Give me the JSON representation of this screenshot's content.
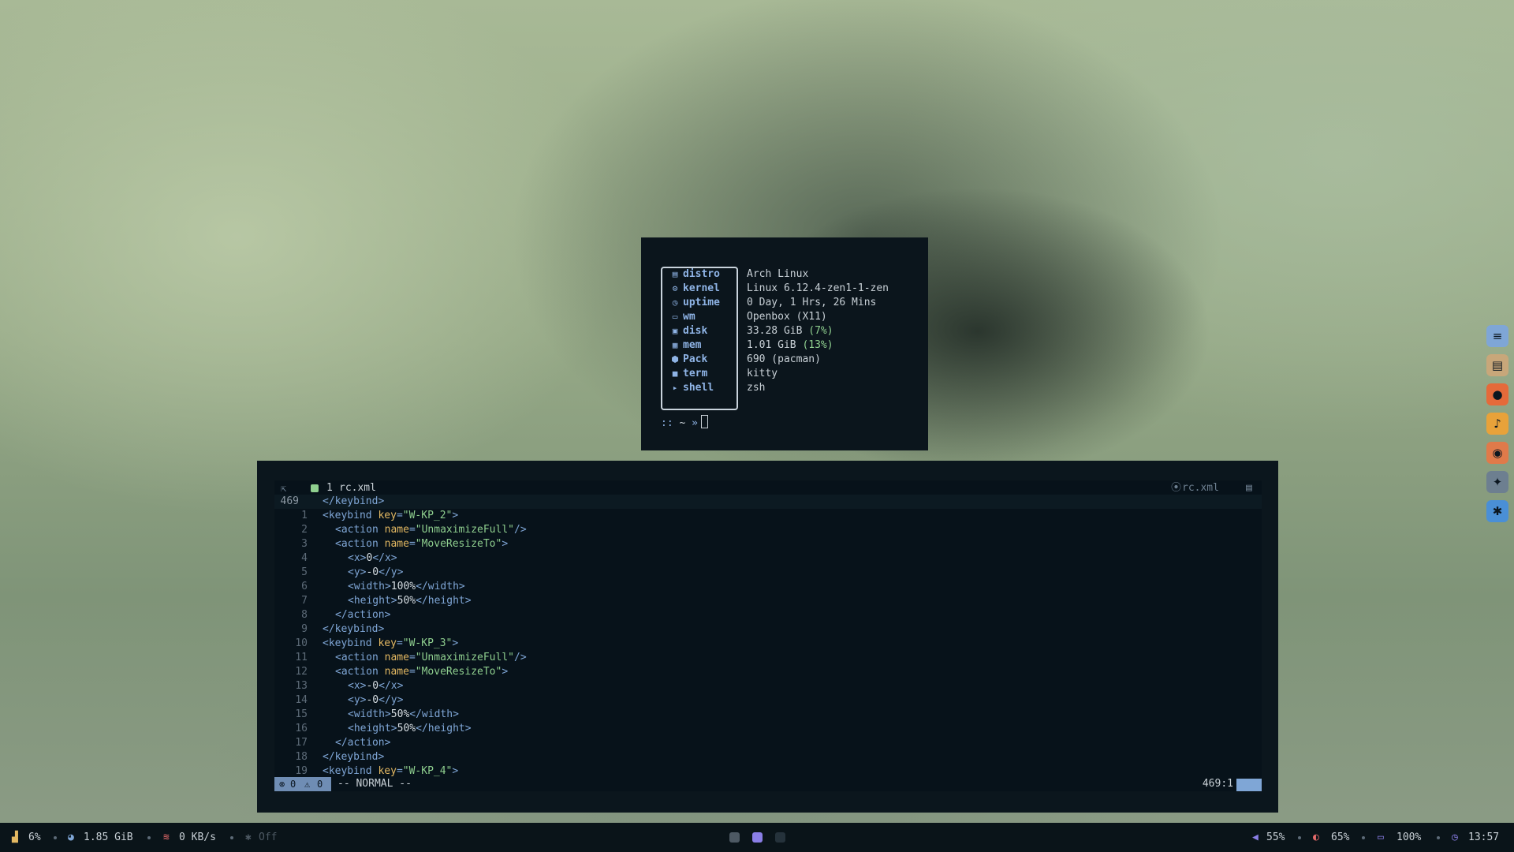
{
  "fetch": {
    "rows": [
      {
        "icon": "distro-icon",
        "glyph": "▤",
        "label": "distro",
        "value": "Arch Linux"
      },
      {
        "icon": "kernel-icon",
        "glyph": "⚙",
        "label": "kernel",
        "value": "Linux 6.12.4-zen1-1-zen"
      },
      {
        "icon": "uptime-icon",
        "glyph": "◷",
        "label": "uptime",
        "value": "0 Day, 1 Hrs, 26 Mins"
      },
      {
        "icon": "monitor-icon",
        "glyph": "▭",
        "label": "wm",
        "value": "Openbox (X11)"
      },
      {
        "icon": "disk-icon",
        "glyph": "▣",
        "label": "disk",
        "value": "33.28 GiB ",
        "accent": "(7%)"
      },
      {
        "icon": "memory-icon",
        "glyph": "▦",
        "label": "mem",
        "value": "1.01 GiB ",
        "accent": "(13%)"
      },
      {
        "icon": "package-icon",
        "glyph": "⬢",
        "label": "Pack",
        "value": "690 (pacman)"
      },
      {
        "icon": "terminal-icon",
        "glyph": "■",
        "label": "term",
        "value": "kitty"
      },
      {
        "icon": "shell-icon",
        "glyph": "▸",
        "label": "shell",
        "value": "zsh"
      }
    ],
    "prompt": {
      "prefix": "::",
      "dir": "~",
      "arrow": "»"
    }
  },
  "editor": {
    "tab_number": "1",
    "tab_filename": "rc.xml",
    "winbar_filename": "rc.xml",
    "current_line_number": "469",
    "lines": [
      {
        "ln": "469",
        "indent": 0,
        "tokens": [
          [
            "tag",
            "</keybind>"
          ]
        ]
      },
      {
        "ln": "1",
        "indent": 0,
        "tokens": [
          [
            "tag",
            "<keybind "
          ],
          [
            "attr",
            "key"
          ],
          [
            "tag",
            "="
          ],
          [
            "str",
            "\"W-KP_2\""
          ],
          [
            "tag",
            ">"
          ]
        ]
      },
      {
        "ln": "2",
        "indent": 1,
        "tokens": [
          [
            "tag",
            "<action "
          ],
          [
            "attr",
            "name"
          ],
          [
            "tag",
            "="
          ],
          [
            "str",
            "\"UnmaximizeFull\""
          ],
          [
            "tag",
            "/>"
          ]
        ]
      },
      {
        "ln": "3",
        "indent": 1,
        "tokens": [
          [
            "tag",
            "<action "
          ],
          [
            "attr",
            "name"
          ],
          [
            "tag",
            "="
          ],
          [
            "str",
            "\"MoveResizeTo\""
          ],
          [
            "tag",
            ">"
          ]
        ]
      },
      {
        "ln": "4",
        "indent": 2,
        "tokens": [
          [
            "tag",
            "<x>"
          ],
          [
            "txt",
            "0"
          ],
          [
            "tag",
            "</x>"
          ]
        ]
      },
      {
        "ln": "5",
        "indent": 2,
        "tokens": [
          [
            "tag",
            "<y>"
          ],
          [
            "txt",
            "-0"
          ],
          [
            "tag",
            "</y>"
          ]
        ]
      },
      {
        "ln": "6",
        "indent": 2,
        "tokens": [
          [
            "tag",
            "<width>"
          ],
          [
            "txt",
            "100%"
          ],
          [
            "tag",
            "</width>"
          ]
        ]
      },
      {
        "ln": "7",
        "indent": 2,
        "tokens": [
          [
            "tag",
            "<height>"
          ],
          [
            "txt",
            "50%"
          ],
          [
            "tag",
            "</height>"
          ]
        ]
      },
      {
        "ln": "8",
        "indent": 1,
        "tokens": [
          [
            "tag",
            "</action>"
          ]
        ]
      },
      {
        "ln": "9",
        "indent": 0,
        "tokens": [
          [
            "tag",
            "</keybind>"
          ]
        ]
      },
      {
        "ln": "10",
        "indent": 0,
        "tokens": [
          [
            "tag",
            "<keybind "
          ],
          [
            "attr",
            "key"
          ],
          [
            "tag",
            "="
          ],
          [
            "str",
            "\"W-KP_3\""
          ],
          [
            "tag",
            ">"
          ]
        ]
      },
      {
        "ln": "11",
        "indent": 1,
        "tokens": [
          [
            "tag",
            "<action "
          ],
          [
            "attr",
            "name"
          ],
          [
            "tag",
            "="
          ],
          [
            "str",
            "\"UnmaximizeFull\""
          ],
          [
            "tag",
            "/>"
          ]
        ]
      },
      {
        "ln": "12",
        "indent": 1,
        "tokens": [
          [
            "tag",
            "<action "
          ],
          [
            "attr",
            "name"
          ],
          [
            "tag",
            "="
          ],
          [
            "str",
            "\"MoveResizeTo\""
          ],
          [
            "tag",
            ">"
          ]
        ]
      },
      {
        "ln": "13",
        "indent": 2,
        "tokens": [
          [
            "tag",
            "<x>"
          ],
          [
            "txt",
            "-0"
          ],
          [
            "tag",
            "</x>"
          ]
        ]
      },
      {
        "ln": "14",
        "indent": 2,
        "tokens": [
          [
            "tag",
            "<y>"
          ],
          [
            "txt",
            "-0"
          ],
          [
            "tag",
            "</y>"
          ]
        ]
      },
      {
        "ln": "15",
        "indent": 2,
        "tokens": [
          [
            "tag",
            "<width>"
          ],
          [
            "txt",
            "50%"
          ],
          [
            "tag",
            "</width>"
          ]
        ]
      },
      {
        "ln": "16",
        "indent": 2,
        "tokens": [
          [
            "tag",
            "<height>"
          ],
          [
            "txt",
            "50%"
          ],
          [
            "tag",
            "</height>"
          ]
        ]
      },
      {
        "ln": "17",
        "indent": 1,
        "tokens": [
          [
            "tag",
            "</action>"
          ]
        ]
      },
      {
        "ln": "18",
        "indent": 0,
        "tokens": [
          [
            "tag",
            "</keybind>"
          ]
        ]
      },
      {
        "ln": "19",
        "indent": 0,
        "tokens": [
          [
            "tag",
            "<keybind "
          ],
          [
            "attr",
            "key"
          ],
          [
            "tag",
            "="
          ],
          [
            "str",
            "\"W-KP_4\""
          ],
          [
            "tag",
            ">"
          ]
        ]
      }
    ],
    "status": {
      "errors": "0",
      "warnings": "0",
      "mode": "-- NORMAL --",
      "position": "469:1"
    }
  },
  "dock": [
    {
      "name": "settings-app-icon",
      "color": "#7fa6d6"
    },
    {
      "name": "file-manager-icon",
      "color": "#c8a77a"
    },
    {
      "name": "firefox-icon",
      "color": "#e56a3a"
    },
    {
      "name": "media-player-icon",
      "color": "#e8a23a"
    },
    {
      "name": "image-viewer-icon",
      "color": "#e07a4a"
    },
    {
      "name": "gamepad-icon",
      "color": "#6d7f90"
    },
    {
      "name": "bluetooth-icon",
      "color": "#4a8fd6"
    }
  ],
  "bar": {
    "cpu": "6%",
    "memory": "1.85 GiB",
    "network": "0 KB/s",
    "bluetooth": "Off",
    "volume": "55%",
    "brightness": "65%",
    "battery": "100%",
    "clock": "13:57",
    "workspaces": [
      {
        "state": "occupied",
        "color": "#4d5963"
      },
      {
        "state": "active",
        "color": "#8a7ee6"
      },
      {
        "state": "empty",
        "color": "#25323b"
      }
    ]
  }
}
